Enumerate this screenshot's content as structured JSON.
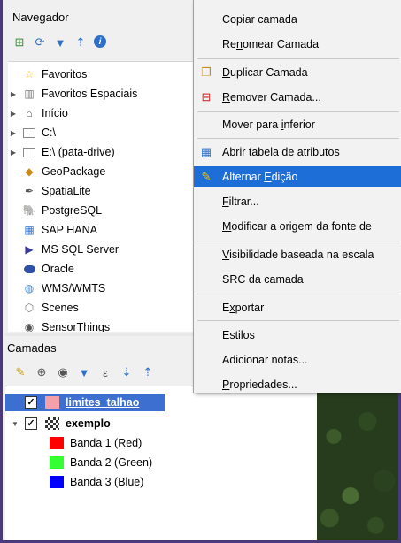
{
  "navigator": {
    "title": "Navegador",
    "items": [
      {
        "label": "Favoritos",
        "icon": "star-icon",
        "arrow": ""
      },
      {
        "label": "Favoritos Espaciais",
        "icon": "spatial-bookmark-icon",
        "arrow": "▶"
      },
      {
        "label": "Início",
        "icon": "home-folder-icon",
        "arrow": "▶"
      },
      {
        "label": "C:\\",
        "icon": "folder-icon",
        "arrow": "▶"
      },
      {
        "label": "E:\\ (pata-drive)",
        "icon": "folder-icon",
        "arrow": "▶"
      },
      {
        "label": "GeoPackage",
        "icon": "geopackage-icon",
        "arrow": ""
      },
      {
        "label": "SpatiaLite",
        "icon": "spatialite-icon",
        "arrow": ""
      },
      {
        "label": "PostgreSQL",
        "icon": "postgresql-icon",
        "arrow": ""
      },
      {
        "label": "SAP HANA",
        "icon": "sap-hana-icon",
        "arrow": ""
      },
      {
        "label": "MS SQL Server",
        "icon": "mssql-icon",
        "arrow": ""
      },
      {
        "label": "Oracle",
        "icon": "oracle-icon",
        "arrow": ""
      },
      {
        "label": "WMS/WMTS",
        "icon": "wms-icon",
        "arrow": ""
      },
      {
        "label": "Scenes",
        "icon": "scenes-icon",
        "arrow": ""
      },
      {
        "label": "SensorThings",
        "icon": "sensorthings-icon",
        "arrow": ""
      }
    ]
  },
  "layers": {
    "title": "Camadas",
    "items": [
      {
        "name": "limites_talhao",
        "checked": "✓"
      },
      {
        "name": "exemplo",
        "checked": "✓"
      }
    ],
    "bands": [
      {
        "label": "Banda 1 (Red)",
        "color": "#ff0000"
      },
      {
        "label": "Banda 2 (Green)",
        "color": "#33ff33"
      },
      {
        "label": "Banda 3 (Blue)",
        "color": "#0000ff"
      }
    ]
  },
  "menu": {
    "items": [
      {
        "pre": "Copiar camada",
        "u": "",
        "post": ""
      },
      {
        "pre": "Re",
        "u": "n",
        "post": "omear Camada"
      },
      {
        "pre": "",
        "u": "D",
        "post": "uplicar Camada"
      },
      {
        "pre": "",
        "u": "R",
        "post": "emover Camada..."
      },
      {
        "pre": "Mover para ",
        "u": "i",
        "post": "nferior"
      },
      {
        "pre": "Abrir tabela de ",
        "u": "a",
        "post": "tributos"
      },
      {
        "pre": "Alternar ",
        "u": "E",
        "post": "dição"
      },
      {
        "pre": "",
        "u": "F",
        "post": "iltrar..."
      },
      {
        "pre": "",
        "u": "M",
        "post": "odificar a origem da fonte de"
      },
      {
        "pre": "",
        "u": "V",
        "post": "isibilidade baseada na escala"
      },
      {
        "pre": "SRC da camada",
        "u": "",
        "post": ""
      },
      {
        "pre": "E",
        "u": "x",
        "post": "portar"
      },
      {
        "pre": "Estilos",
        "u": "",
        "post": ""
      },
      {
        "pre": "Adicionar notas...",
        "u": "",
        "post": ""
      },
      {
        "pre": "",
        "u": "P",
        "post": "ropriedades..."
      }
    ]
  },
  "colors": {
    "highlight": "#1e6ed8",
    "link": "#1a56c8"
  }
}
